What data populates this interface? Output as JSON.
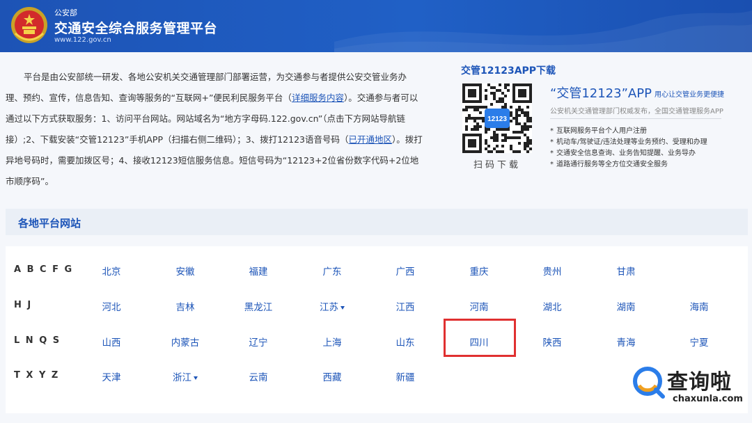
{
  "header": {
    "subtitle": "公安部",
    "title": "交通安全综合服务管理平台",
    "url": "www.122.gov.cn"
  },
  "intro": {
    "part1": "平台是由公安部统一研发、各地公安机关交通管理部门部署运营，为交通参与者提供公安交管业务办理、预约、宣传，信息告知、查询等服务的“互联网+”便民利民服务平台（",
    "link1": "详细服务内容",
    "part2": "）。交通参与者可以通过以下方式获取服务：1、访问平台网站。网站域名为“地方字母码.122.gov.cn”（点击下方网站导航链接）;2、下载安装“交管12123”手机APP（扫描右侧二维码）；3、拨打12123语音号码（",
    "link2": "已开通地区",
    "part3": "）。拨打异地号码时，需要加拨区号；4、接收12123短信服务信息。短信号码为“12123+2位省份数字代码+2位地市顺序码”。"
  },
  "app": {
    "section_title": "交管12123APP下载",
    "qr_center_text": "12123",
    "scan_label": "扫码下载",
    "name": "“交管12123”APP",
    "slogan": "用心让交管业务更便捷",
    "description": "公安机关交通管理部门权威发布，全国交通管理服务APP",
    "features": [
      "互联网服务平台个人用户注册",
      "机动车/驾驶证/违法处理等业务预约、受理和办理",
      "交通安全信息查询、业务告知提醒、业务导办",
      "道路通行服务等全方位交通安全服务"
    ]
  },
  "sites": {
    "section_title": "各地平台网站",
    "rows": [
      {
        "label": "A B C F G",
        "items": [
          "北京",
          "安徽",
          "福建",
          "广东",
          "广西",
          "重庆",
          "贵州",
          "甘肃"
        ]
      },
      {
        "label": "H J",
        "items": [
          "河北",
          "吉林",
          "黑龙江",
          "江苏",
          "江西",
          "河南",
          "湖北",
          "湖南",
          "海南"
        ]
      },
      {
        "label": "L N Q S",
        "items": [
          "山西",
          "内蒙古",
          "辽宁",
          "上海",
          "山东",
          "四川",
          "陕西",
          "青海",
          "宁夏"
        ]
      },
      {
        "label": "T X Y Z",
        "items": [
          "天津",
          "浙江",
          "云南",
          "西藏",
          "新疆"
        ]
      }
    ],
    "dropdown_items": [
      "江苏",
      "浙江"
    ],
    "highlighted": "四川"
  },
  "watermark": {
    "text": "查询啦",
    "url": "chaxunla.com"
  },
  "colors": {
    "header_blue": "#1d53b5",
    "link_blue": "#1d55b8",
    "highlight_red": "#e03030",
    "section_bg": "#eaeff6"
  }
}
